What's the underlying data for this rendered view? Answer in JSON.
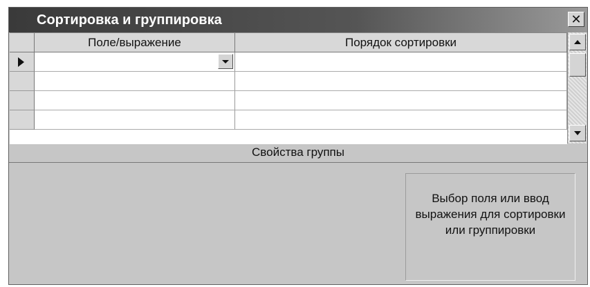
{
  "window": {
    "title": "Сортировка и группировка"
  },
  "grid": {
    "columns": [
      "Поле/выражение",
      "Порядок сортировки"
    ],
    "rows": [
      {
        "field": "",
        "sort_order": ""
      },
      {
        "field": "",
        "sort_order": ""
      },
      {
        "field": "",
        "sort_order": ""
      },
      {
        "field": "",
        "sort_order": ""
      }
    ]
  },
  "group_properties": {
    "title": "Свойства группы",
    "help_text": "Выбор поля или ввод выражения для сортировки или группировки"
  },
  "icons": {
    "close": "close-icon",
    "row_selector": "current-row-arrow-icon",
    "dropdown": "chevron-down-icon",
    "scroll_up": "arrow-up-icon",
    "scroll_down": "arrow-down-icon"
  }
}
